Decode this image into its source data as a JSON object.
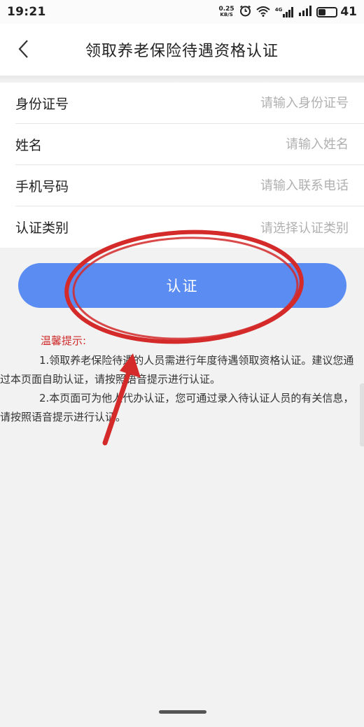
{
  "status_bar": {
    "time": "19:21",
    "net_speed_value": "0.25",
    "net_speed_unit": "KB/S",
    "net_type": "4G",
    "battery_level": "41"
  },
  "header": {
    "title": "领取养老保险待遇资格认证"
  },
  "form": {
    "id_label": "身份证号",
    "id_placeholder": "请输入身份证号",
    "name_label": "姓名",
    "name_placeholder": "请输入姓名",
    "phone_label": "手机号码",
    "phone_placeholder": "请输入联系电话",
    "category_label": "认证类别",
    "category_placeholder": "请选择认证类别"
  },
  "actions": {
    "certify_label": "认证"
  },
  "tips": {
    "title": "温馨提示:",
    "item1": "1.领取养老保险待遇的人员需进行年度待遇领取资格认证。建议您通过本页面自助认证，请按照语音提示进行认证。",
    "item2": "2.本页面可为他人代办认证，您可通过录入待认证人员的有关信息，请按照语音提示进行认证。"
  },
  "colors": {
    "primary": "#5b8cf2",
    "tip_title": "#cf2d2d",
    "annotation_red": "#d42a2a"
  },
  "icons": {
    "back": "chevron-left-icon",
    "alarm": "alarm-clock-icon",
    "wifi": "wifi-icon",
    "signal": "signal-icon",
    "battery": "battery-icon"
  }
}
